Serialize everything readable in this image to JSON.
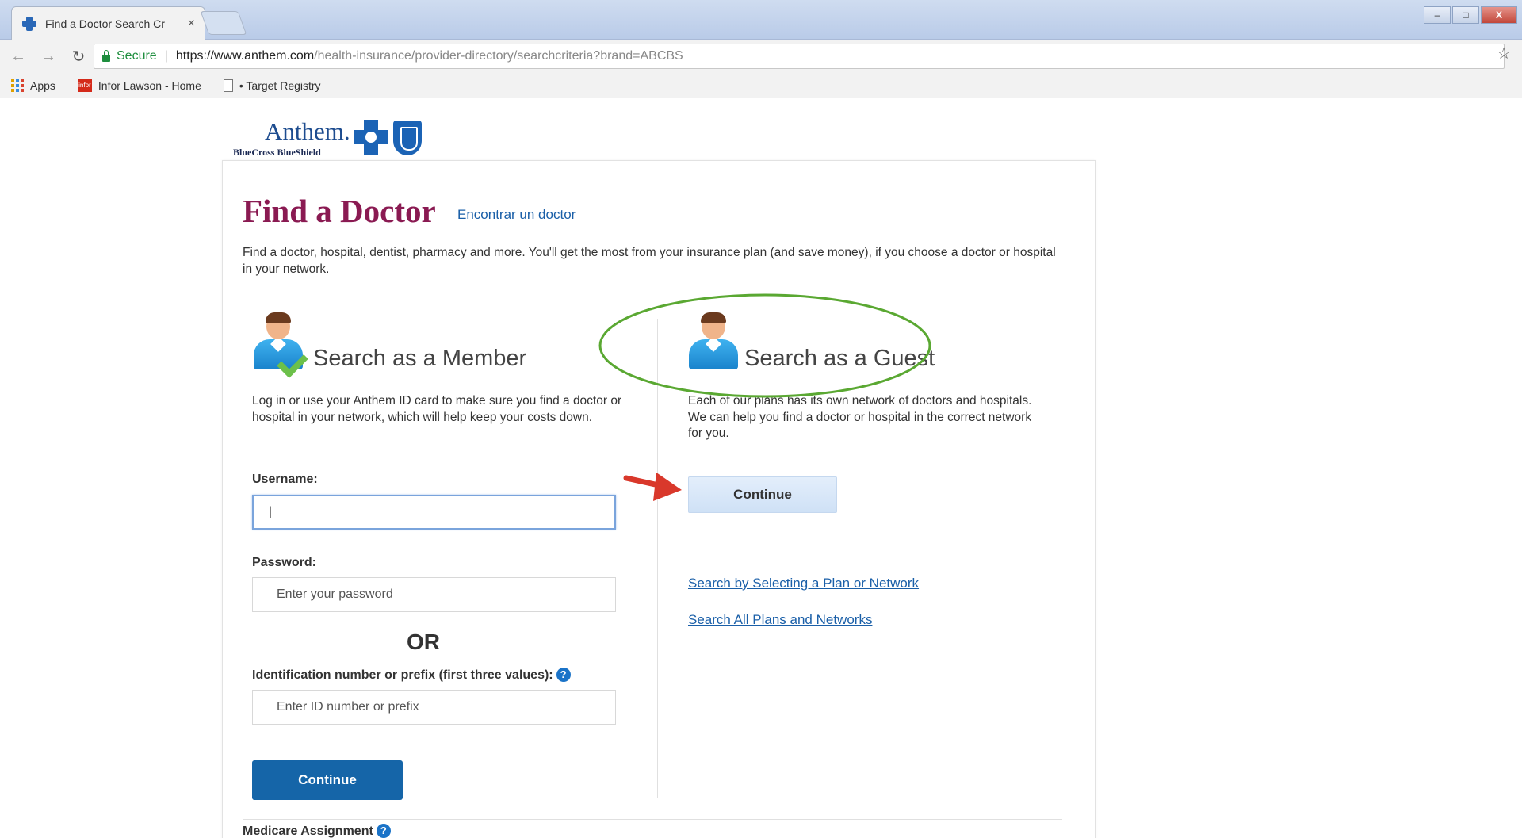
{
  "browser": {
    "tab_title": "Find a Doctor Search Cr",
    "tab_close": "×",
    "window_controls": {
      "minimize": "–",
      "maximize": "□",
      "close": "X"
    },
    "address": {
      "secure_label": "Secure",
      "separator": "|",
      "url_host": "https://www.anthem.com",
      "url_path": "/health-insurance/provider-directory/searchcriteria?brand=ABCBS"
    },
    "bookmarks": [
      {
        "label": "Apps",
        "icon": "apps-grid-icon"
      },
      {
        "label": "Infor Lawson - Home",
        "icon": "infor-icon"
      },
      {
        "label": "• Target Registry",
        "icon": "page-icon"
      }
    ]
  },
  "logo": {
    "word": "Anthem.",
    "sub": "BlueCross BlueShield"
  },
  "page": {
    "title": "Find a Doctor",
    "spanish_link": "Encontrar un doctor",
    "intro": "Find a doctor, hospital, dentist, pharmacy and more. You'll get the most from your insurance plan (and save money), if you choose a doctor or hospital in your network."
  },
  "member": {
    "title": "Search as a Member",
    "description": "Log in or use your Anthem ID card to make sure you find a doctor or hospital in your network, which will help keep your costs down.",
    "username_label": "Username:",
    "username_value": "|",
    "password_label": "Password:",
    "password_placeholder": "Enter your password",
    "or_label": "OR",
    "id_label": "Identification number or prefix (first three values):",
    "id_placeholder": "Enter ID number or prefix",
    "continue_label": "Continue"
  },
  "guest": {
    "title": "Search as a Guest",
    "description": "Each of our plans has its own network of doctors and hospitals. We can help you find a doctor or hospital in the correct network for you.",
    "continue_label": "Continue",
    "link_plan": "Search by Selecting a Plan or Network",
    "link_all": "Search All Plans and Networks"
  },
  "footer": {
    "medicare_label": "Medicare Assignment",
    "help_glyph": "?"
  },
  "colors": {
    "title_maroon": "#8a1a52",
    "link_blue": "#1a5fa8",
    "primary_button": "#1565a8",
    "annotation_green": "#5aa832",
    "annotation_red": "#d9382b"
  }
}
